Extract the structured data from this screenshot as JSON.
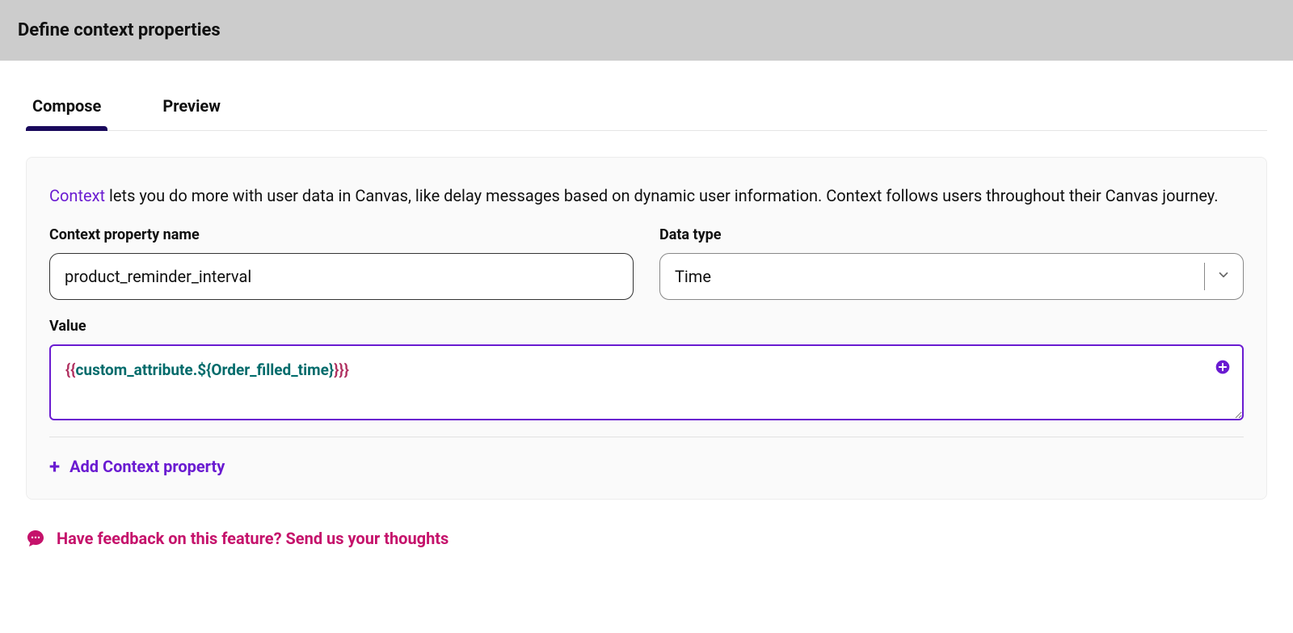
{
  "header": {
    "title": "Define context properties"
  },
  "tabs": {
    "compose": "Compose",
    "preview": "Preview"
  },
  "panel": {
    "context_link": "Context",
    "description_rest": " lets you do more with user data in Canvas, like delay messages based on dynamic user information. Context follows users throughout their Canvas journey.",
    "property_name_label": "Context property name",
    "property_name_value": "product_reminder_interval",
    "data_type_label": "Data type",
    "data_type_value": "Time",
    "value_label": "Value",
    "value_tokens": {
      "open": "{{",
      "attr": "custom_attribute",
      "dot": ".",
      "inner": "${Order_filled_time}",
      "close": "}}}"
    },
    "add_property_label": "Add Context property"
  },
  "feedback": {
    "text": "Have feedback on this feature? Send us your thoughts"
  }
}
